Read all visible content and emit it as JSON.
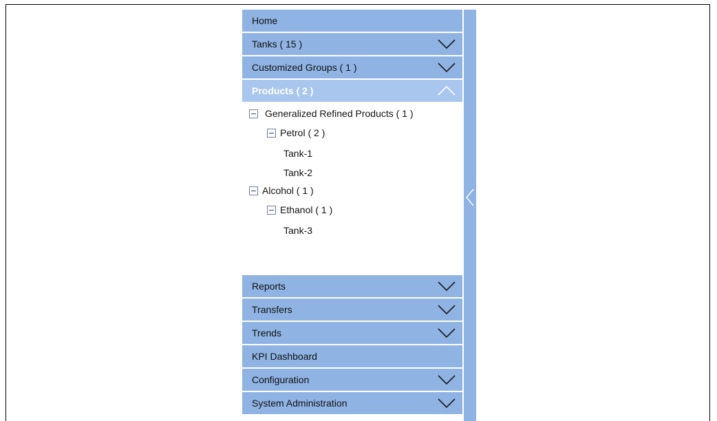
{
  "nav": {
    "home": "Home",
    "tanks": "Tanks ( 15 )",
    "groups": "Customized Groups ( 1 )",
    "products": "Products ( 2 )",
    "reports": "Reports",
    "transfers": "Transfers",
    "trends": "Trends",
    "kpi": "KPI Dashboard",
    "configuration": "Configuration",
    "sysadmin": "System Administration"
  },
  "tree": {
    "generalized": "Generalized Refined Products ( 1 )",
    "petrol": "Petrol ( 2 )",
    "tank1": "Tank-1",
    "tank2": "Tank-2",
    "alcohol": "Alcohol ( 1 )",
    "ethanol": "Ethanol ( 1 )",
    "tank3": "Tank-3"
  },
  "colors": {
    "header_bg": "#8fb3e3",
    "active_header_bg": "#a9c6ee"
  }
}
